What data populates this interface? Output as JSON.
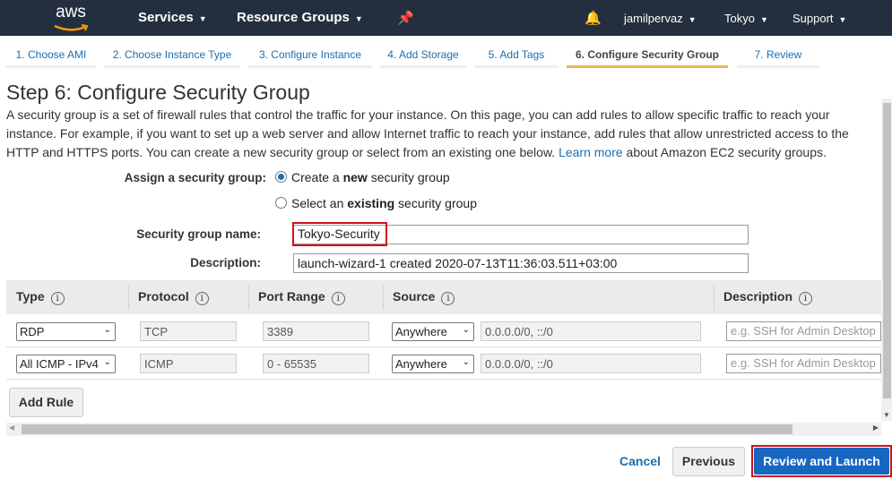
{
  "nav": {
    "logo": "aws",
    "services": "Services",
    "resource_groups": "Resource Groups",
    "user": "jamilpervaz",
    "region": "Tokyo",
    "support": "Support"
  },
  "tabs": [
    "1. Choose AMI",
    "2. Choose Instance Type",
    "3. Configure Instance",
    "4. Add Storage",
    "5. Add Tags",
    "6. Configure Security Group",
    "7. Review"
  ],
  "active_tab": 5,
  "page": {
    "title": "Step 6: Configure Security Group",
    "intro": "A security group is a set of firewall rules that control the traffic for your instance. On this page, you can add rules to allow specific traffic to reach your instance. For example, if you want to set up a web server and allow Internet traffic to reach your instance, add rules that allow unrestricted access to the HTTP and HTTPS ports. You can create a new security group or select from an existing one below.",
    "learn_more": "Learn more",
    "intro_end": "about Amazon EC2 security groups."
  },
  "form": {
    "assign_label": "Assign a security group:",
    "opt_new_pre": "Create a ",
    "opt_new_bold": "new",
    "opt_new_post": " security group",
    "opt_existing_pre": "Select an ",
    "opt_existing_bold": "existing",
    "opt_existing_post": " security group",
    "selected": "new",
    "name_label": "Security group name:",
    "name_value": "Tokyo-Security",
    "desc_label": "Description:",
    "desc_value": "launch-wizard-1 created 2020-07-13T11:36:03.511+03:00"
  },
  "table": {
    "headers": [
      "Type",
      "Protocol",
      "Port Range",
      "Source",
      "Description"
    ],
    "rows": [
      {
        "type": "RDP",
        "protocol": "TCP",
        "port": "3389",
        "source": "Anywhere",
        "cidr": "0.0.0.0/0, ::/0",
        "desc_placeholder": "e.g. SSH for Admin Desktop"
      },
      {
        "type": "All ICMP - IPv4",
        "protocol": "ICMP",
        "port": "0 - 65535",
        "source": "Anywhere",
        "cidr": "0.0.0.0/0, ::/0",
        "desc_placeholder": "e.g. SSH for Admin Desktop"
      }
    ]
  },
  "add_rule": "Add Rule",
  "footer": {
    "cancel": "Cancel",
    "previous": "Previous",
    "review": "Review and Launch"
  },
  "colors": {
    "nav": "#232f3e",
    "accent": "#1a6fb0",
    "active_tab": "#e6b949",
    "highlight": "#d0101c"
  }
}
